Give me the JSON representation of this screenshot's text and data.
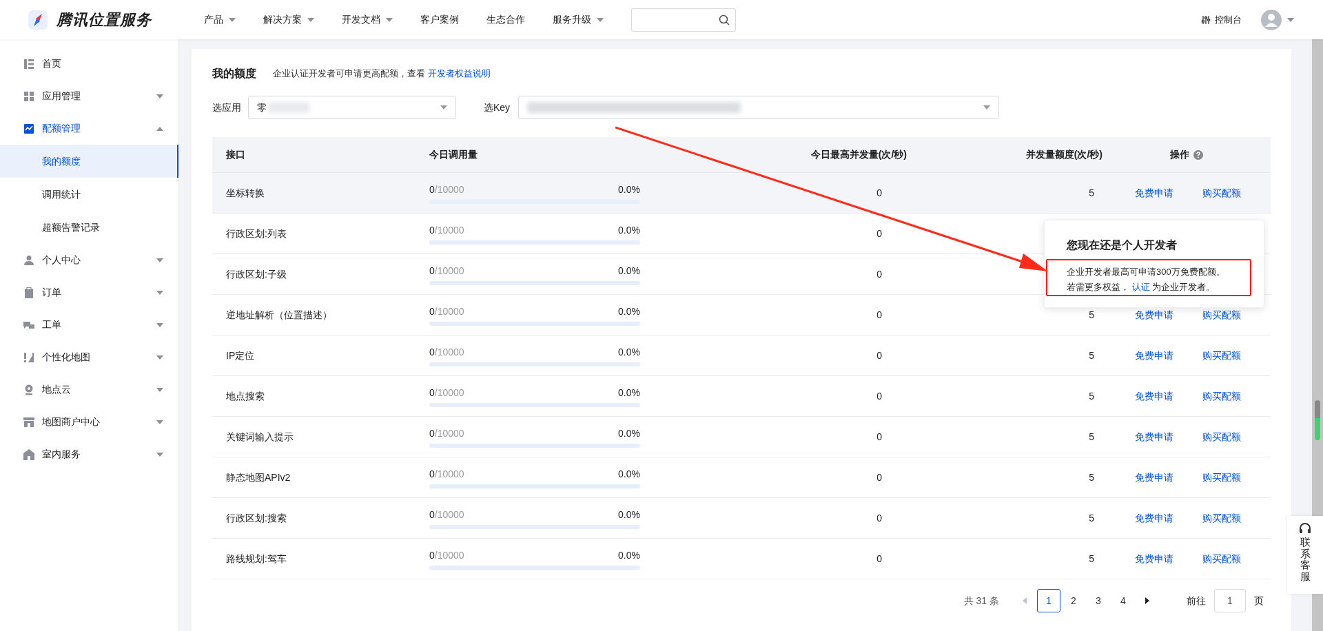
{
  "header": {
    "logo_text": "腾讯位置服务",
    "nav": [
      {
        "label": "产品",
        "dropdown": true
      },
      {
        "label": "解决方案",
        "dropdown": true
      },
      {
        "label": "开发文档",
        "dropdown": true
      },
      {
        "label": "客户案例",
        "dropdown": false
      },
      {
        "label": "生态合作",
        "dropdown": false
      },
      {
        "label": "服务升级",
        "dropdown": true
      }
    ],
    "console": "控制台"
  },
  "sidebar": {
    "items": [
      {
        "label": "首页",
        "kind": "list"
      },
      {
        "label": "应用管理",
        "kind": "grid",
        "expanded": false
      },
      {
        "label": "配额管理",
        "kind": "chart",
        "expanded": true,
        "children": [
          {
            "label": "我的额度",
            "selected": true
          },
          {
            "label": "调用统计",
            "selected": false
          },
          {
            "label": "超额告警记录",
            "selected": false
          }
        ]
      },
      {
        "label": "个人中心",
        "kind": "user",
        "expanded": false
      },
      {
        "label": "订单",
        "kind": "clipboard",
        "expanded": false
      },
      {
        "label": "工单",
        "kind": "chat",
        "expanded": false
      },
      {
        "label": "个性化地图",
        "kind": "style",
        "expanded": false
      },
      {
        "label": "地点云",
        "kind": "pin",
        "expanded": false
      },
      {
        "label": "地图商户中心",
        "kind": "store",
        "expanded": false
      },
      {
        "label": "室内服务",
        "kind": "home",
        "expanded": false
      }
    ]
  },
  "page": {
    "title": "我的额度",
    "note": "企业认证开发者可申请更高配额，查看",
    "note_link": "开发者权益说明",
    "app_select": {
      "label": "选应用",
      "value": "零"
    },
    "key_select": {
      "label": "选Key"
    }
  },
  "table": {
    "columns": [
      "接口",
      "今日调用量",
      "今日最高并发量(次/秒)",
      "并发量额度(次/秒)",
      "操作"
    ],
    "rows": [
      {
        "name": "坐标转换",
        "used": "0",
        "limit": "/10000",
        "level": 0,
        "percent": "0.0%",
        "peak": "0",
        "quota": "5",
        "actions": [
          "免费申请",
          "购买配额"
        ],
        "selected": true
      },
      {
        "name": "行政区划:列表",
        "used": "0",
        "limit": "/10000",
        "level": 0,
        "percent": "0.0%",
        "peak": "0",
        "selected": false
      },
      {
        "name": "行政区划:子级",
        "used": "0",
        "limit": "/10000",
        "level": 0,
        "percent": "0.0%",
        "peak": "0",
        "selected": false
      },
      {
        "name": "逆地址解析（位置描述）",
        "used": "0",
        "limit": "/10000",
        "level": 0,
        "percent": "0.0%",
        "peak": "0",
        "quota": "5",
        "actions": [
          "免费申请",
          "购买配额"
        ],
        "selected": false
      },
      {
        "name": "IP定位",
        "used": "0",
        "limit": "/10000",
        "level": 0,
        "percent": "0.0%",
        "peak": "0",
        "quota": "5",
        "actions": [
          "免费申请",
          "购买配额"
        ],
        "selected": false
      },
      {
        "name": "地点搜索",
        "used": "0",
        "limit": "/10000",
        "level": 0,
        "percent": "0.0%",
        "peak": "0",
        "quota": "5",
        "actions": [
          "免费申请",
          "购买配额"
        ],
        "selected": false
      },
      {
        "name": "关键词输入提示",
        "used": "0",
        "limit": "/10000",
        "level": 0,
        "percent": "0.0%",
        "peak": "0",
        "quota": "5",
        "actions": [
          "免费申请",
          "购买配额"
        ],
        "selected": false
      },
      {
        "name": "静态地图APIv2",
        "used": "0",
        "limit": "/10000",
        "level": 0,
        "percent": "0.0%",
        "peak": "0",
        "quota": "5",
        "actions": [
          "免费申请",
          "购买配额"
        ],
        "selected": false
      },
      {
        "name": "行政区划:搜索",
        "used": "0",
        "limit": "/10000",
        "level": 0,
        "percent": "0.0%",
        "peak": "0",
        "quota": "5",
        "actions": [
          "免费申请",
          "购买配额"
        ],
        "selected": false
      },
      {
        "name": "路线规划:驾车",
        "used": "0",
        "limit": "/10000",
        "level": 0,
        "percent": "0.0%",
        "peak": "0",
        "quota": "5",
        "actions": [
          "免费申请",
          "购买配额"
        ],
        "selected": false
      }
    ]
  },
  "popover": {
    "title": "您现在还是个人开发者",
    "line1": "企业开发者最高可申请300万免费配额。",
    "line2_before": "若需更多权益，",
    "line2_link": "认证",
    "line2_after": "为企业开发者。"
  },
  "pagination": {
    "total": "共 31 条",
    "pages": [
      {
        "label": "1",
        "selected": true
      },
      {
        "label": "2",
        "selected": false
      },
      {
        "label": "3",
        "selected": false
      },
      {
        "label": "4",
        "selected": false
      }
    ],
    "goto_label": "前往",
    "goto_value": "1",
    "goto_suffix": "页"
  },
  "contact": {
    "label": "联系客服"
  }
}
